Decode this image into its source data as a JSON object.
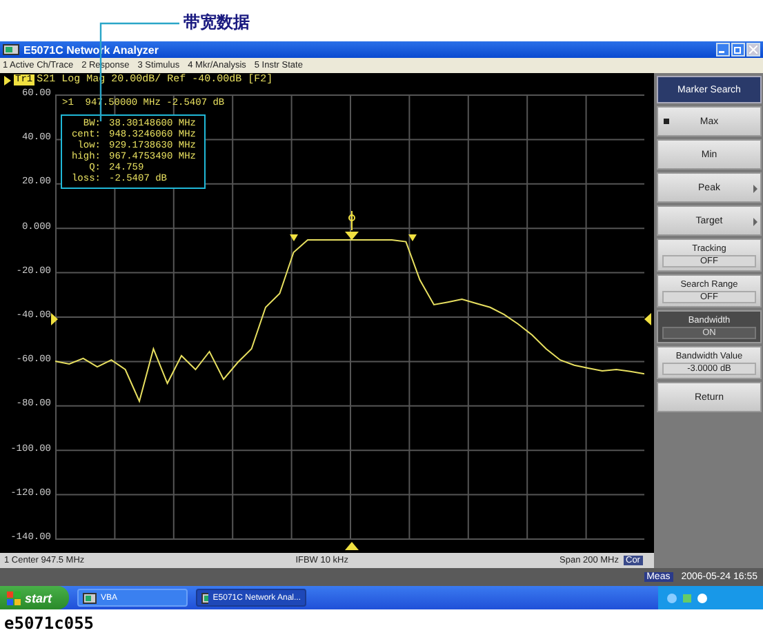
{
  "annotation": {
    "text": "带宽数据"
  },
  "window": {
    "title": "E5071C Network Analyzer"
  },
  "menu": [
    "1 Active Ch/Trace",
    "2 Response",
    "3 Stimulus",
    "4 Mkr/Analysis",
    "5 Instr State"
  ],
  "trace_header": {
    "badge": "Tr1",
    "text": "S21 Log Mag 20.00dB/ Ref -40.00dB [F2]"
  },
  "chart_data": {
    "type": "line",
    "grid": true,
    "ylim": [
      -140,
      60
    ],
    "yticks": [
      {
        "value": 60,
        "label": "60.00"
      },
      {
        "value": 40,
        "label": "40.00"
      },
      {
        "value": 20,
        "label": "20.00"
      },
      {
        "value": 0,
        "label": "0.000"
      },
      {
        "value": -20,
        "label": "-20.00"
      },
      {
        "value": -40,
        "label": "-40.00"
      },
      {
        "value": -60,
        "label": "-60.00"
      },
      {
        "value": -80,
        "label": "-80.00"
      },
      {
        "value": -100,
        "label": "-100.00"
      },
      {
        "value": -120,
        "label": "-120.00"
      },
      {
        "value": -140,
        "label": "-140.00"
      }
    ],
    "categories": [
      null,
      null,
      null,
      null,
      null,
      null,
      null,
      null,
      null,
      null,
      null,
      null,
      null,
      null,
      null,
      null,
      null,
      null,
      null,
      null,
      null,
      null,
      null,
      null,
      null,
      null,
      null,
      null,
      null,
      null,
      null,
      null,
      null,
      null,
      null,
      null,
      null,
      null,
      null,
      null,
      null,
      null,
      null
    ],
    "series": [
      {
        "color": "#e8e060",
        "values": [
          -59.9,
          -61.1,
          -58.6,
          -62.4,
          -59.3,
          -63.6,
          -77.9,
          -54.3,
          -69.8,
          -57.4,
          -63.6,
          -55.5,
          -68.0,
          -60.5,
          -54.3,
          -35.6,
          -29.4,
          -10.8,
          -5.2,
          -5.2,
          -5.2,
          -5.2,
          -5.2,
          -5.2,
          -5.2,
          -6.0,
          -23.2,
          -34.4,
          -33.2,
          -31.9,
          -33.8,
          -35.6,
          -38.8,
          -43.1,
          -48.1,
          -54.3,
          -59.3,
          -61.7,
          -63.0,
          -64.2,
          -63.6,
          -64.5,
          -65.5
        ]
      }
    ]
  },
  "marker_readout": ">1  947.50000 MHz -2.5407 dB",
  "bandwidth_data": [
    {
      "label": "BW:",
      "value": "38.30148600 MHz"
    },
    {
      "label": "cent:",
      "value": "948.3246060 MHz"
    },
    {
      "label": "low:",
      "value": "929.1738630 MHz"
    },
    {
      "label": "high:",
      "value": "967.4753490 MHz"
    },
    {
      "label": "Q:",
      "value": "24.759"
    },
    {
      "label": "loss:",
      "value": "-2.5407 dB"
    }
  ],
  "status_bar": {
    "center": "1 Center 947.5 MHz",
    "ifbw": "IFBW 10 kHz",
    "span": "Span 200 MHz",
    "badge": "Cor"
  },
  "softkeys": {
    "title": "Marker Search",
    "items": [
      {
        "kind": "action",
        "label": "Max",
        "marked": true,
        "selected": false
      },
      {
        "kind": "action",
        "label": "Min",
        "marked": false,
        "selected": false
      },
      {
        "kind": "submenu",
        "label": "Peak",
        "marked": false,
        "selected": false
      },
      {
        "kind": "submenu",
        "label": "Target",
        "marked": false,
        "selected": false
      },
      {
        "kind": "value",
        "label": "Tracking",
        "value": "OFF",
        "marked": false,
        "selected": false
      },
      {
        "kind": "value",
        "label": "Search Range",
        "value": "OFF",
        "marked": false,
        "selected": false
      },
      {
        "kind": "value",
        "label": "Bandwidth",
        "value": "ON",
        "marked": false,
        "selected": true
      },
      {
        "kind": "value",
        "label": "Bandwidth Value",
        "value": "-3.0000 dB",
        "marked": false,
        "selected": false
      },
      {
        "kind": "action",
        "label": "Return",
        "marked": false,
        "selected": false
      }
    ]
  },
  "meas_bar": {
    "label": "Meas",
    "datetime": "2006-05-24 16:55"
  },
  "taskbar": {
    "start": "start",
    "items": [
      {
        "label": "VBA",
        "selected": false
      },
      {
        "label": "E5071C Network Anal...",
        "selected": true
      }
    ]
  },
  "caption": "e5071c055"
}
